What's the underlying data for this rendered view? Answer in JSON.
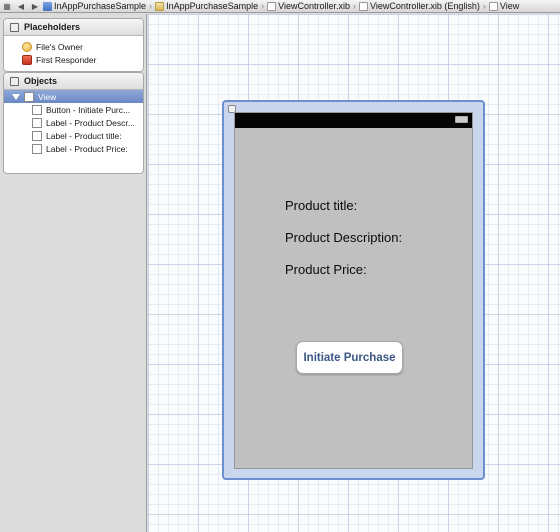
{
  "jumpbar": {
    "crumbs": [
      "InAppPurchaseSample",
      "InAppPurchaseSample",
      "ViewController.xib",
      "ViewController.xib (English)",
      "View"
    ]
  },
  "placeholders": {
    "title": "Placeholders",
    "items": [
      "File's Owner",
      "First Responder"
    ]
  },
  "objects": {
    "title": "Objects",
    "root": "View",
    "items": [
      "Button - Initiate Purc...",
      "Label - Product Descr...",
      "Label - Product title:",
      "Label - Product Price:"
    ]
  },
  "canvas": {
    "labels": {
      "title": "Product title:",
      "description": "Product Description:",
      "price": "Product Price:"
    },
    "button_label": "Initiate Purchase"
  },
  "colors": {
    "selection": "#6a88c4",
    "view_frame": "#6b8fcf",
    "device_bg": "#c0c0c0",
    "button_text": "#3d5785"
  }
}
